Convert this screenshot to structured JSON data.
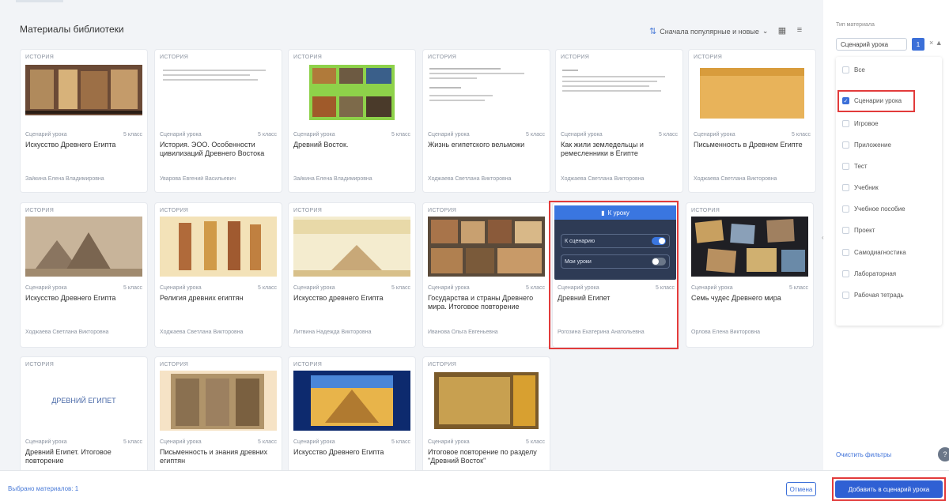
{
  "header": {
    "title": "Материалы библиотеки",
    "sort_label": "Сначала популярные и новые",
    "sort_icon": "sort-icon",
    "grid_icon": "grid-view-icon",
    "list_icon": "list-view-icon"
  },
  "cards": [
    {
      "subject": "ИСТОРИЯ",
      "type": "Сценарий урока",
      "grade": "5 класс",
      "title": "Искусство Древнего Египта",
      "author": "Зайкина Елена Владимировна"
    },
    {
      "subject": "ИСТОРИЯ",
      "type": "Сценарий урока",
      "grade": "5 класс",
      "title": "История. ЭОО. Особенности цивилизаций Древнего Востока",
      "author": "Уварова Евгений Васильевич"
    },
    {
      "subject": "ИСТОРИЯ",
      "type": "Сценарий урока",
      "grade": "5 класс",
      "title": "Древний Восток.",
      "author": "Зайкина Елена Владимировна"
    },
    {
      "subject": "ИСТОРИЯ",
      "type": "Сценарий урока",
      "grade": "5 класс",
      "title": "Жизнь египетского вельможи",
      "author": "Ходжаева Светлана Викторовна"
    },
    {
      "subject": "ИСТОРИЯ",
      "type": "Сценарий урока",
      "grade": "5 класс",
      "title": "Как жили земледельцы и ремесленники в Египте",
      "author": "Ходжаева Светлана Викторовна"
    },
    {
      "subject": "ИСТОРИЯ",
      "type": "Сценарий урока",
      "grade": "5 класс",
      "title": "Письменность в Древнем Египте",
      "author": "Ходжаева Светлана Викторовна"
    },
    {
      "subject": "ИСТОРИЯ",
      "type": "Сценарий урока",
      "grade": "5 класс",
      "title": "Искусство Древнего Египта",
      "author": "Ходжаева Светлана Викторовна"
    },
    {
      "subject": "ИСТОРИЯ",
      "type": "Сценарий урока",
      "grade": "5 класс",
      "title": "Религия древних египтян",
      "author": "Ходжаева Светлана Викторовна"
    },
    {
      "subject": "ИСТОРИЯ",
      "type": "Сценарий урока",
      "grade": "5 класс",
      "title": "Искусство древнего Египта",
      "author": "Литвина Надежда Викторовна"
    },
    {
      "subject": "ИСТОРИЯ",
      "type": "Сценарий урока",
      "grade": "5 класс",
      "title": "Государства и страны Древнего мира. Итоговое повторение",
      "author": "Иванова Ольга Евгеньевна"
    },
    {
      "subject": "",
      "type": "Сценарий урока",
      "grade": "5 класс",
      "title": "Древний Египет",
      "author": "Рогозина Екатерина Анатольевна"
    },
    {
      "subject": "ИСТОРИЯ",
      "type": "Сценарий урока",
      "grade": "5 класс",
      "title": "Семь чудес Древнего мира",
      "author": "Орлова Елена Викторовна"
    },
    {
      "subject": "ИСТОРИЯ",
      "type": "Сценарий урока",
      "grade": "5 класс",
      "title": "Древний Египет. Итоговое повторение",
      "author": ""
    },
    {
      "subject": "ИСТОРИЯ",
      "type": "Сценарий урока",
      "grade": "5 класс",
      "title": "Письменность и знания древних египтян",
      "author": ""
    },
    {
      "subject": "ИСТОРИЯ",
      "type": "Сценарий урока",
      "grade": "5 класс",
      "title": "Искусство Древнего Египта",
      "author": ""
    },
    {
      "subject": "ИСТОРИЯ",
      "type": "Сценарий урока",
      "grade": "5 класс",
      "title": "Итоговое повторение по разделу \"Древний Восток\"",
      "author": ""
    }
  ],
  "overlay_card": {
    "header": "К уроку",
    "toggle1": "К сценарию",
    "toggle2": "Мои уроки"
  },
  "thumb_texts": {
    "t13": "ДРЕВНИЙ ЕГИПЕТ"
  },
  "sidebar": {
    "filter_label": "Тип материала",
    "select_value": "Сценарий урока",
    "count": "1",
    "ctrls": "× ▲",
    "options": [
      {
        "label": "Все",
        "checked": false
      },
      {
        "label": "Сценарии урока",
        "checked": true
      },
      {
        "label": "Игровое",
        "checked": false
      },
      {
        "label": "Приложение",
        "checked": false
      },
      {
        "label": "Тест",
        "checked": false
      },
      {
        "label": "Учебник",
        "checked": false
      },
      {
        "label": "Учебное пособие",
        "checked": false
      },
      {
        "label": "Проект",
        "checked": false
      },
      {
        "label": "Самодиагностика",
        "checked": false
      },
      {
        "label": "Лабораторная",
        "checked": false
      },
      {
        "label": "Рабочая тетрадь",
        "checked": false
      }
    ],
    "clear_label": "Очистить фильтры",
    "help_icon": "help-icon"
  },
  "footer": {
    "selected_label": "Выбрано материалов: 1",
    "cancel_label": "Отмена",
    "add_label": "Добавить в сценарий урока"
  },
  "colors": {
    "accent": "#2f60d4",
    "highlight": "#e23b3b"
  }
}
